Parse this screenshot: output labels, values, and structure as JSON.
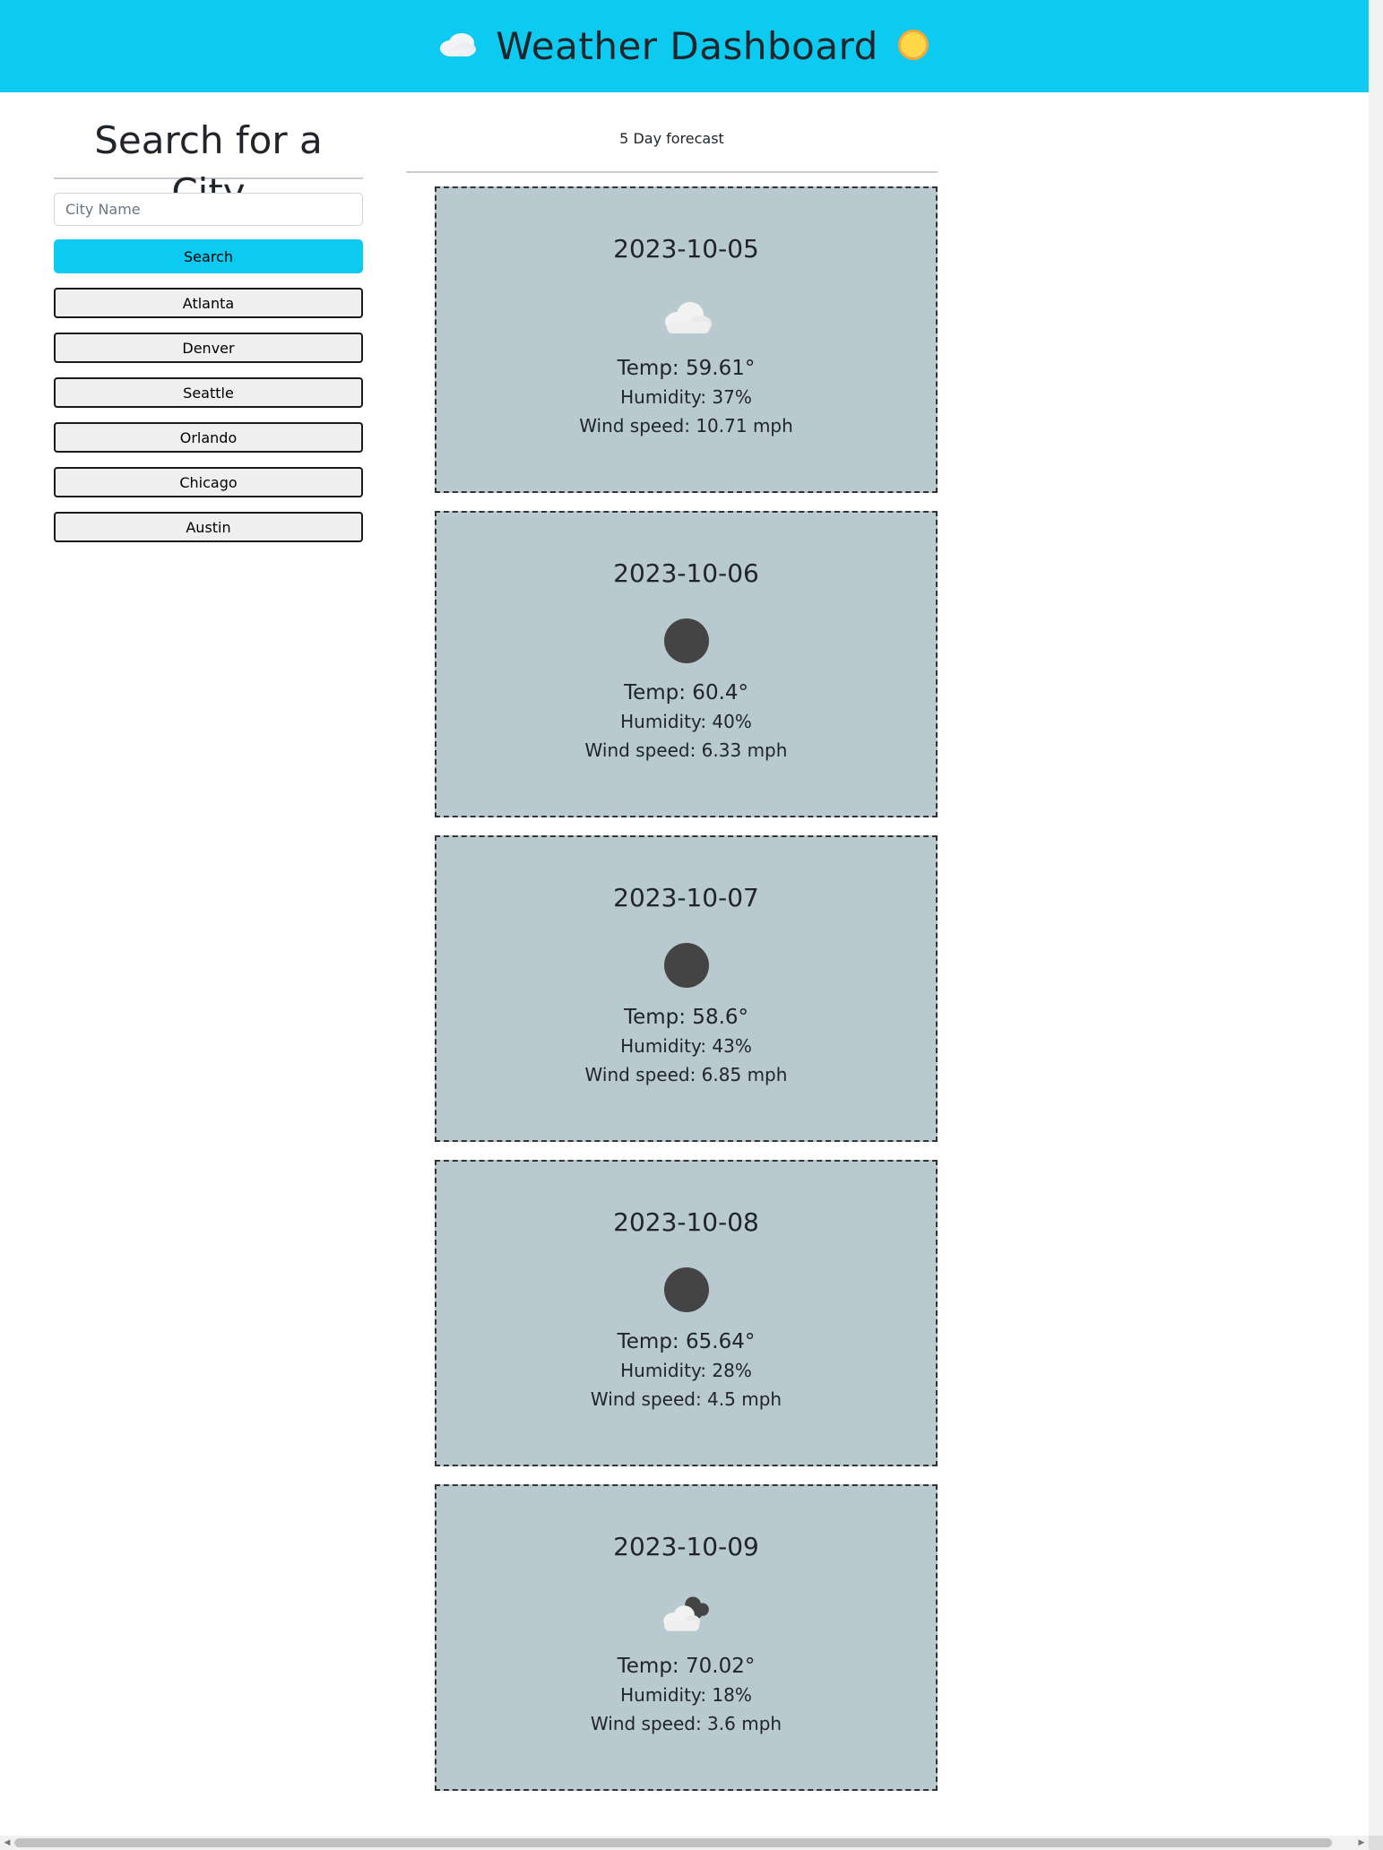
{
  "header": {
    "title": "Weather Dashboard",
    "left_icon": "cloud-icon",
    "right_icon": "sun-icon",
    "background": "#0dcaf0"
  },
  "sidebar": {
    "title": "Search for a City",
    "search_input": {
      "placeholder": "City Name",
      "value": ""
    },
    "search_button": "Search",
    "history": [
      "Atlanta",
      "Denver",
      "Seattle",
      "Orlando",
      "Chicago",
      "Austin"
    ]
  },
  "forecast": {
    "heading": "5 Day forecast",
    "cards": [
      {
        "date": "2023-10-05",
        "icon": "cloud-icon",
        "temp": "Temp: 59.61°",
        "humidity": "Humidity: 37%",
        "wind": "Wind speed: 10.71 mph"
      },
      {
        "date": "2023-10-06",
        "icon": "clear-night-icon",
        "temp": "Temp: 60.4°",
        "humidity": "Humidity: 40%",
        "wind": "Wind speed: 6.33 mph"
      },
      {
        "date": "2023-10-07",
        "icon": "clear-night-icon",
        "temp": "Temp: 58.6°",
        "humidity": "Humidity: 43%",
        "wind": "Wind speed: 6.85 mph"
      },
      {
        "date": "2023-10-08",
        "icon": "clear-night-icon",
        "temp": "Temp: 65.64°",
        "humidity": "Humidity: 28%",
        "wind": "Wind speed: 4.5 mph"
      },
      {
        "date": "2023-10-09",
        "icon": "partly-cloudy-night-icon",
        "temp": "Temp: 70.02°",
        "humidity": "Humidity: 18%",
        "wind": "Wind speed: 3.6 mph"
      }
    ]
  },
  "colors": {
    "accent": "#0dcaf0",
    "card_background": "#b8c9d0",
    "night_icon": "#444444"
  }
}
